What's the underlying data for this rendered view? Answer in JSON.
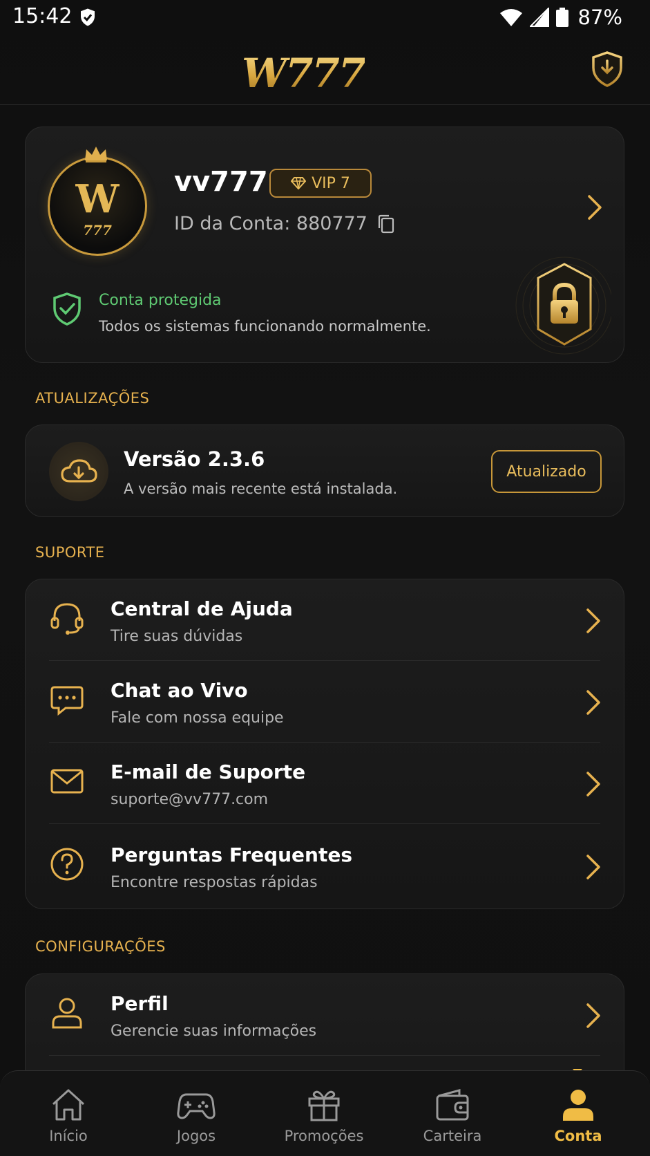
{
  "status_bar": {
    "time": "15:42",
    "battery": "87%"
  },
  "header": {
    "logo": "W777"
  },
  "profile": {
    "avatar_letter": "W",
    "avatar_number": "777",
    "username": "vv777",
    "vip_label": "VIP 7",
    "account_id": "ID da Conta: 880777",
    "protection_title": "Conta protegida",
    "protection_desc": "Todos os sistemas funcionando normalmente."
  },
  "updates": {
    "section_title": "ATUALIZAÇÕES",
    "version": "Versão 2.3.6",
    "description": "A versão mais recente está instalada.",
    "button_label": "Atualizado"
  },
  "support": {
    "section_title": "SUPORTE",
    "items": [
      {
        "title": "Central de Ajuda",
        "subtitle": "Tire suas dúvidas",
        "icon": "headset-icon"
      },
      {
        "title": "Chat ao Vivo",
        "subtitle": "Fale com nossa equipe",
        "icon": "chat-icon"
      },
      {
        "title": "E-mail de Suporte",
        "subtitle": "suporte@vv777.com",
        "icon": "mail-icon"
      },
      {
        "title": "Perguntas Frequentes",
        "subtitle": "Encontre respostas rápidas",
        "icon": "question-icon"
      }
    ]
  },
  "settings": {
    "section_title": "CONFIGURAÇÕES",
    "items": [
      {
        "title": "Perfil",
        "subtitle": "Gerencie suas informações",
        "icon": "user-icon"
      }
    ]
  },
  "nav": {
    "items": [
      {
        "label": "Início",
        "icon": "home-icon",
        "active": false
      },
      {
        "label": "Jogos",
        "icon": "gamepad-icon",
        "active": false
      },
      {
        "label": "Promoções",
        "icon": "gift-icon",
        "active": false
      },
      {
        "label": "Carteira",
        "icon": "wallet-icon",
        "active": false
      },
      {
        "label": "Conta",
        "icon": "user-icon",
        "active": true
      }
    ]
  },
  "colors": {
    "accent": "#e7b24f",
    "success": "#5fca73",
    "background": "#0e0e0e"
  }
}
